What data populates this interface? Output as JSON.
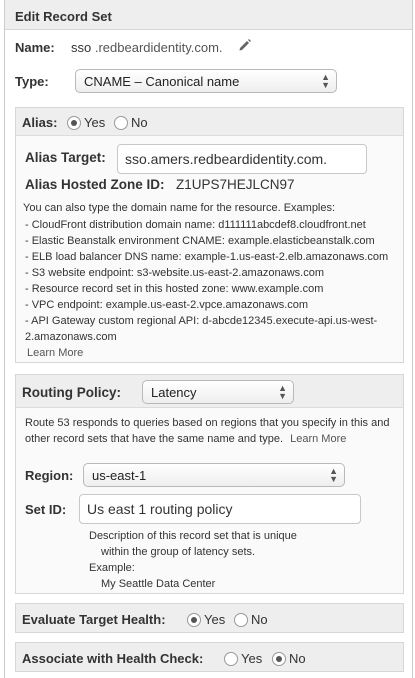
{
  "header": {
    "title": "Edit Record Set"
  },
  "name": {
    "label": "Name:",
    "value": "sso",
    "suffix": ".redbeardidentity.com."
  },
  "type": {
    "label": "Type:",
    "value": "CNAME – Canonical name"
  },
  "alias": {
    "label": "Alias:",
    "yes": "Yes",
    "no": "No",
    "selected": "Yes",
    "target_label": "Alias Target:",
    "target_value": "sso.amers.redbeardidentity.com.",
    "zone_label": "Alias Hosted Zone ID:",
    "zone_value": "Z1UPS7HEJLCN97",
    "intro": "You can also type the domain name for the resource. Examples:",
    "examples": [
      "-  CloudFront distribution domain name: d111111abcdef8.cloudfront.net",
      "-  Elastic Beanstalk environment CNAME: example.elasticbeanstalk.com",
      "-  ELB load balancer DNS name: example-1.us-east-2.elb.amazonaws.com",
      "-  S3 website endpoint: s3-website.us-east-2.amazonaws.com",
      "-  Resource record set in this hosted zone: www.example.com",
      "-  VPC endpoint: example.us-east-2.vpce.amazonaws.com",
      "-  API Gateway custom regional API: d-abcde12345.execute-api.us-west-",
      "2.amazonaws.com"
    ],
    "learn_more": "Learn More"
  },
  "routing": {
    "label": "Routing Policy:",
    "value": "Latency",
    "desc_line1": "Route 53 responds to queries based on regions that you specify in this and",
    "desc_line2": "other record sets that have the same name and type.",
    "learn_more": "Learn More",
    "region_label": "Region:",
    "region_value": "us-east-1",
    "setid_label": "Set ID:",
    "setid_value": "Us east 1 routing policy",
    "help1": "Description of this record set that is unique",
    "help2": "within the group of latency sets.",
    "help3": "Example:",
    "help4": "My Seattle Data Center"
  },
  "evaluate": {
    "label": "Evaluate Target Health:",
    "yes": "Yes",
    "no": "No",
    "selected": "Yes"
  },
  "health": {
    "label": "Associate with Health Check:",
    "yes": "Yes",
    "no": "No",
    "selected": "No"
  },
  "icons": {
    "pencil": "pencil-icon",
    "caret": "select-caret-icon"
  }
}
